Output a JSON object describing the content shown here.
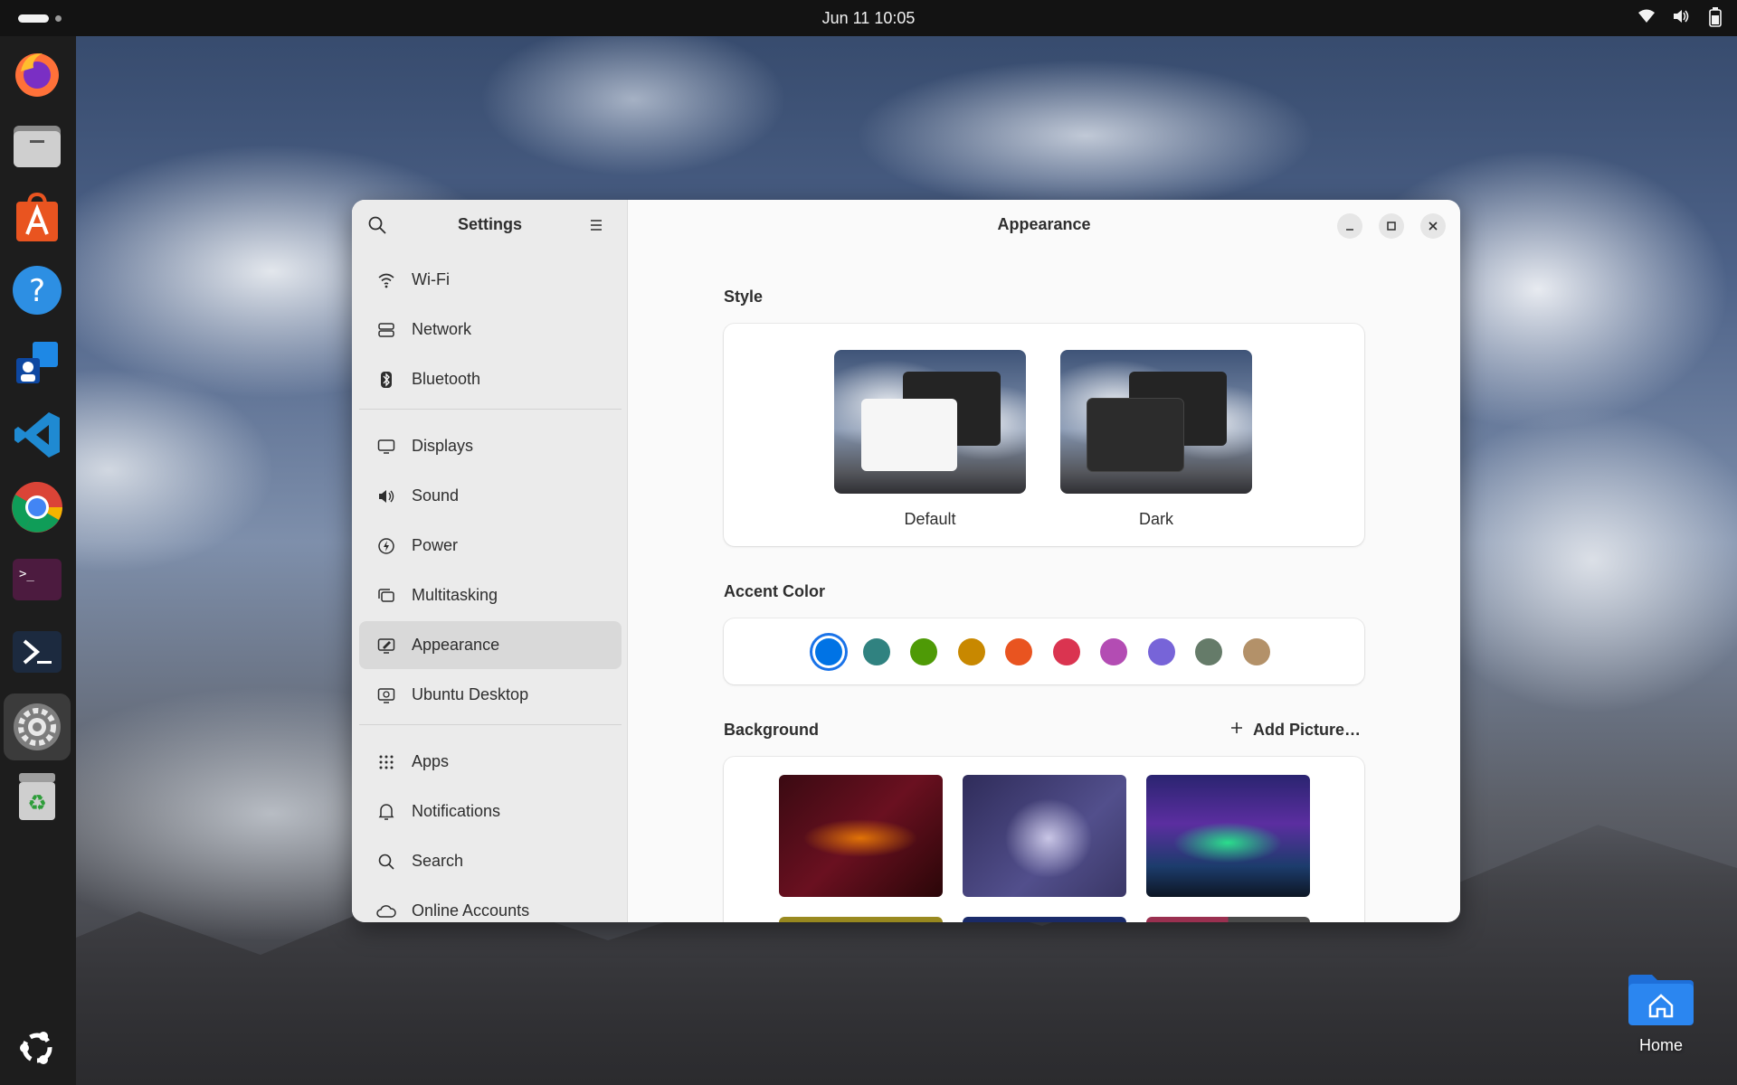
{
  "topbar": {
    "clock": "Jun 11  10:05"
  },
  "dock": {
    "apps": [
      {
        "name": "Firefox",
        "icon": "firefox-icon"
      },
      {
        "name": "Files",
        "icon": "files-icon"
      },
      {
        "name": "App Center",
        "icon": "app-center-icon"
      },
      {
        "name": "Help",
        "icon": "help-icon"
      },
      {
        "name": "Remote Desktop",
        "icon": "remote-desktop-icon"
      },
      {
        "name": "Visual Studio Code",
        "icon": "vscode-icon"
      },
      {
        "name": "Chrome",
        "icon": "chrome-icon"
      },
      {
        "name": "Terminal",
        "icon": "terminal-icon"
      },
      {
        "name": "PowerShell",
        "icon": "powershell-icon"
      },
      {
        "name": "Settings",
        "icon": "settings-icon",
        "active": true
      },
      {
        "name": "Trash",
        "icon": "trash-icon"
      }
    ],
    "show_apps_icon": "ubuntu-logo-icon"
  },
  "settings": {
    "sidebar": {
      "title": "Settings",
      "items": [
        {
          "label": "Wi-Fi",
          "icon": "wifi-icon"
        },
        {
          "label": "Network",
          "icon": "network-icon"
        },
        {
          "label": "Bluetooth",
          "icon": "bluetooth-icon"
        },
        {
          "label": "Displays",
          "icon": "display-icon"
        },
        {
          "label": "Sound",
          "icon": "speaker-icon"
        },
        {
          "label": "Power",
          "icon": "power-icon"
        },
        {
          "label": "Multitasking",
          "icon": "multitasking-icon"
        },
        {
          "label": "Appearance",
          "icon": "appearance-icon",
          "selected": true
        },
        {
          "label": "Ubuntu Desktop",
          "icon": "ubuntu-desktop-icon"
        },
        {
          "label": "Apps",
          "icon": "apps-grid-icon"
        },
        {
          "label": "Notifications",
          "icon": "bell-icon"
        },
        {
          "label": "Search",
          "icon": "search-icon"
        },
        {
          "label": "Online Accounts",
          "icon": "cloud-icon"
        }
      ]
    },
    "content": {
      "title": "Appearance",
      "style": {
        "label": "Style",
        "options": [
          {
            "label": "Default",
            "selected": true
          },
          {
            "label": "Dark",
            "selected": false
          }
        ]
      },
      "accent": {
        "label": "Accent Color",
        "colors": [
          "#0073e5",
          "#308280",
          "#4e9a06",
          "#c88800",
          "#e95420",
          "#da3450",
          "#b34cb3",
          "#7764d8",
          "#657b69",
          "#b39169"
        ],
        "selected_index": 0
      },
      "background": {
        "label": "Background",
        "add_picture_label": "Add Picture…"
      }
    }
  },
  "desktop": {
    "home_label": "Home"
  }
}
